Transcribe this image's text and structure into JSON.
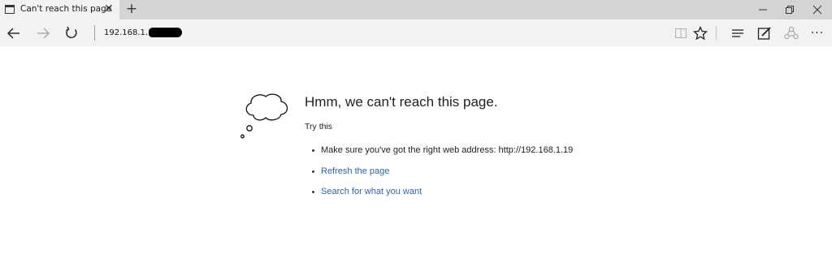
{
  "tab": {
    "title": "Can't reach this page",
    "close_label": "✕"
  },
  "new_tab_label": "+",
  "window_controls": {
    "minimize": "minimize-icon",
    "restore": "restore-icon",
    "close": "close-icon"
  },
  "nav": {
    "back": "back-arrow-icon",
    "forward": "forward-arrow-icon",
    "refresh": "refresh-icon",
    "address": "192.168.1.19",
    "address_redacted": true
  },
  "toolbar": {
    "reading_view": "reading-view-icon",
    "favorite": "star-icon",
    "hub": "hub-icon",
    "web_note": "web-note-icon",
    "share": "share-icon",
    "more_label": "···"
  },
  "error": {
    "heading": "Hmm, we can't reach this page.",
    "try_label": "Try this",
    "suggestions": [
      {
        "text": "Make sure you've got the right web address: http://192.168.1.19",
        "link": false
      },
      {
        "text": "Refresh the page",
        "link": true
      },
      {
        "text": "Search for what you want",
        "link": true
      }
    ]
  },
  "colors": {
    "link": "#2767a9",
    "chrome": "#f2f2f2",
    "tabstrip": "#d4d4d4"
  }
}
